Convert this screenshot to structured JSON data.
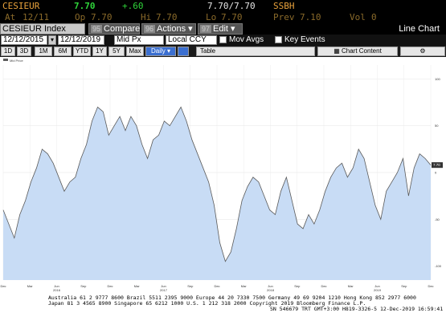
{
  "quote": {
    "ticker": "CESIEUR",
    "last": "7.70",
    "change": "+.60",
    "bid_ask": "7.70/7.70",
    "source": "SSBH",
    "at_label": "At",
    "at_value": "12/11",
    "open_label": "Op",
    "open_value": "7.70",
    "high_label": "Hi",
    "high_value": "7.70",
    "low_label": "Lo",
    "low_value": "7.70",
    "prev_label": "Prev",
    "prev_value": "7.10",
    "vol_label": "Vol",
    "vol_value": "0"
  },
  "menubar": {
    "security": "CESIEUR Index",
    "compare_num": "95",
    "compare": "Compare",
    "actions_num": "96",
    "actions": "Actions ▾",
    "edit_num": "97",
    "edit": "Edit ▾",
    "title": "Line Chart"
  },
  "toolbar": {
    "start_date": "12/12/2015",
    "end_date": "12/12/2019",
    "field": "Mid Px",
    "currency": "Local CCY",
    "mov_avgs": "Mov Avgs",
    "key_events": "Key Events"
  },
  "periods": {
    "items": [
      "1D",
      "3D",
      "1M",
      "6M",
      "YTD",
      "1Y",
      "5Y",
      "Max"
    ],
    "frequency": "Daily ▾",
    "table": "Table",
    "chart_content": "Chart Content"
  },
  "chart_data": {
    "type": "area",
    "legend": "Mid Price",
    "fill_color": "#c8dcf5",
    "line_color": "#5a5a5a",
    "x_labels": [
      "Dec",
      "Mar",
      "Jun",
      "Sep",
      "Dec",
      "Mar",
      "Jun",
      "Sep",
      "Dec",
      "Mar",
      "Jun",
      "Sep",
      "Dec",
      "Mar",
      "Jun",
      "Sep",
      "Dec"
    ],
    "year_labels": [
      "2016",
      "2017",
      "2018",
      "2019"
    ],
    "y_ticks": [
      "100",
      "50",
      "0",
      "-50",
      "-100"
    ],
    "last_value_label": "7.70",
    "y_range": [
      -115,
      115
    ],
    "values": [
      -40,
      -55,
      -70,
      -45,
      -30,
      -10,
      5,
      25,
      20,
      10,
      -5,
      -20,
      -10,
      -5,
      15,
      30,
      55,
      70,
      65,
      40,
      50,
      60,
      45,
      60,
      50,
      30,
      15,
      35,
      40,
      55,
      50,
      60,
      70,
      55,
      35,
      20,
      5,
      -10,
      -35,
      -75,
      -95,
      -85,
      -60,
      -30,
      -15,
      -5,
      -10,
      -25,
      -40,
      -45,
      -20,
      -5,
      -30,
      -55,
      -60,
      -45,
      -55,
      -40,
      -20,
      -5,
      5,
      10,
      -5,
      5,
      25,
      15,
      -10,
      -35,
      -50,
      -20,
      -10,
      0,
      15,
      -25,
      5,
      20,
      15,
      8
    ]
  },
  "footer": {
    "line1": "Australia 61 2 9777 8600  Brazil 5511 2395 9000  Europe 44 20 7330 7500  Germany 49 69 9204 1210  Hong Kong 852 2977 6000",
    "line2": "Japan 81 3 4565 8900       Singapore 65 6212 1000       U.S. 1 212 318 2000           Copyright 2019 Bloomberg Finance L.P.",
    "line3": "SN 546679 TRT  GMT+3:00 H819-3326-5  12-Dec-2019 16:59:41"
  }
}
